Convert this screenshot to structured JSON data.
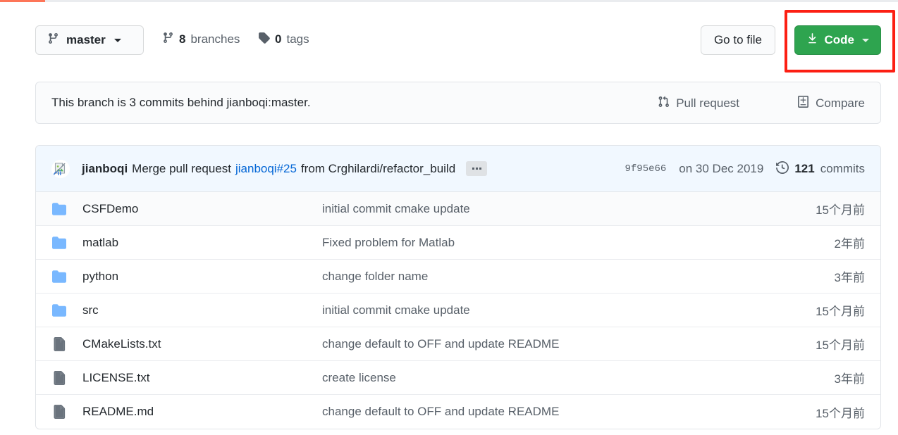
{
  "progress": {
    "percent": 5,
    "color": "#fd7558"
  },
  "branch_bar": {
    "branch_icon": "git-branch-icon",
    "branch_name": "master",
    "branches_count": "8",
    "branches_label": "branches",
    "tags_icon": "tag-icon",
    "tags_count": "0",
    "tags_label": "tags",
    "goto_file_label": "Go to file",
    "code_label": "Code",
    "code_icon": "download-icon",
    "code_color": "#2ea44f",
    "highlight_color": "#fc1f13"
  },
  "branch_status": {
    "text": "This branch is 3 commits behind jianboqi:master.",
    "pull_request_label": "Pull request",
    "pull_request_icon": "git-pull-request-icon",
    "compare_label": "Compare",
    "compare_icon": "diff-icon"
  },
  "commit": {
    "avatar_icon": "broken-image-icon",
    "author": "jianboqi",
    "message_prefix": "Merge pull request",
    "message_link": "jianboqi#25",
    "message_suffix": "from Crghilardi/refactor_build",
    "expand_label": "...",
    "sha": "9f95e66",
    "date": "on 30 Dec 2019",
    "commits_count": "121",
    "commits_label": "commits",
    "history_icon": "history-icon"
  },
  "files": [
    {
      "icon": "folder-icon",
      "type": "folder",
      "name": "CSFDemo",
      "message": "initial commit cmake update",
      "age": "15个月前"
    },
    {
      "icon": "folder-icon",
      "type": "folder",
      "name": "matlab",
      "message": "Fixed problem for Matlab",
      "age": "2年前"
    },
    {
      "icon": "folder-icon",
      "type": "folder",
      "name": "python",
      "message": "change folder name",
      "age": "3年前"
    },
    {
      "icon": "folder-icon",
      "type": "folder",
      "name": "src",
      "message": "initial commit cmake update",
      "age": "15个月前"
    },
    {
      "icon": "file-icon",
      "type": "file",
      "name": "CMakeLists.txt",
      "message": "change default to OFF and update README",
      "age": "15个月前"
    },
    {
      "icon": "file-icon",
      "type": "file",
      "name": "LICENSE.txt",
      "message": "create license",
      "age": "3年前"
    },
    {
      "icon": "file-icon",
      "type": "file",
      "name": "README.md",
      "message": "change default to OFF and update README",
      "age": "15个月前"
    }
  ]
}
